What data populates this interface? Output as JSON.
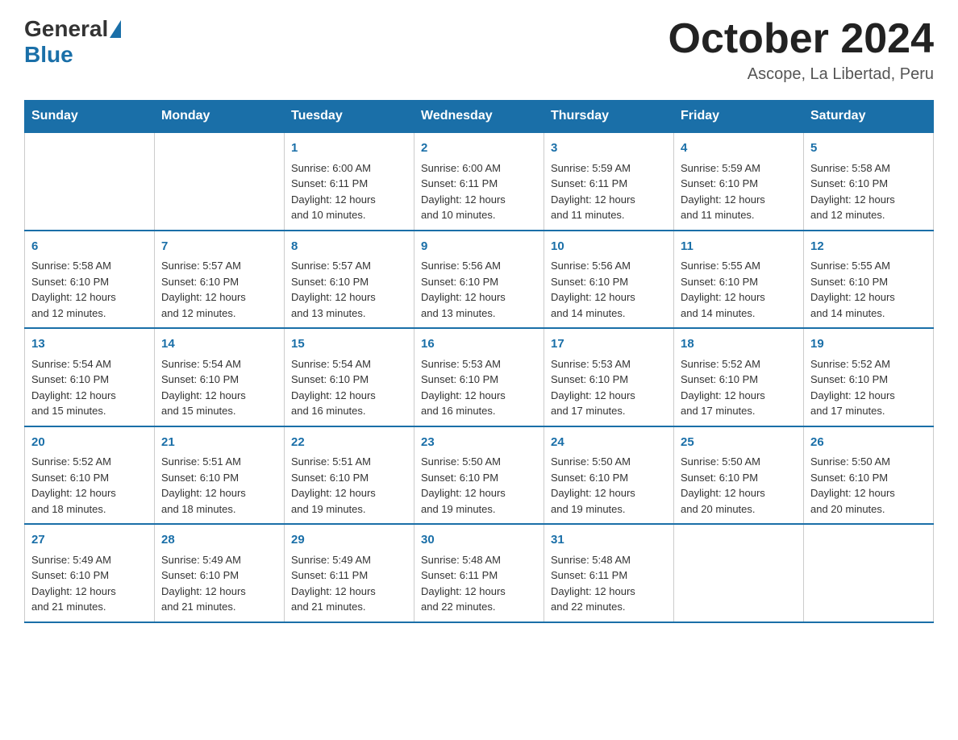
{
  "header": {
    "logo_general": "General",
    "logo_blue": "Blue",
    "month_title": "October 2024",
    "location": "Ascope, La Libertad, Peru"
  },
  "weekdays": [
    "Sunday",
    "Monday",
    "Tuesday",
    "Wednesday",
    "Thursday",
    "Friday",
    "Saturday"
  ],
  "weeks": [
    [
      {
        "day": "",
        "info": ""
      },
      {
        "day": "",
        "info": ""
      },
      {
        "day": "1",
        "info": "Sunrise: 6:00 AM\nSunset: 6:11 PM\nDaylight: 12 hours\nand 10 minutes."
      },
      {
        "day": "2",
        "info": "Sunrise: 6:00 AM\nSunset: 6:11 PM\nDaylight: 12 hours\nand 10 minutes."
      },
      {
        "day": "3",
        "info": "Sunrise: 5:59 AM\nSunset: 6:11 PM\nDaylight: 12 hours\nand 11 minutes."
      },
      {
        "day": "4",
        "info": "Sunrise: 5:59 AM\nSunset: 6:10 PM\nDaylight: 12 hours\nand 11 minutes."
      },
      {
        "day": "5",
        "info": "Sunrise: 5:58 AM\nSunset: 6:10 PM\nDaylight: 12 hours\nand 12 minutes."
      }
    ],
    [
      {
        "day": "6",
        "info": "Sunrise: 5:58 AM\nSunset: 6:10 PM\nDaylight: 12 hours\nand 12 minutes."
      },
      {
        "day": "7",
        "info": "Sunrise: 5:57 AM\nSunset: 6:10 PM\nDaylight: 12 hours\nand 12 minutes."
      },
      {
        "day": "8",
        "info": "Sunrise: 5:57 AM\nSunset: 6:10 PM\nDaylight: 12 hours\nand 13 minutes."
      },
      {
        "day": "9",
        "info": "Sunrise: 5:56 AM\nSunset: 6:10 PM\nDaylight: 12 hours\nand 13 minutes."
      },
      {
        "day": "10",
        "info": "Sunrise: 5:56 AM\nSunset: 6:10 PM\nDaylight: 12 hours\nand 14 minutes."
      },
      {
        "day": "11",
        "info": "Sunrise: 5:55 AM\nSunset: 6:10 PM\nDaylight: 12 hours\nand 14 minutes."
      },
      {
        "day": "12",
        "info": "Sunrise: 5:55 AM\nSunset: 6:10 PM\nDaylight: 12 hours\nand 14 minutes."
      }
    ],
    [
      {
        "day": "13",
        "info": "Sunrise: 5:54 AM\nSunset: 6:10 PM\nDaylight: 12 hours\nand 15 minutes."
      },
      {
        "day": "14",
        "info": "Sunrise: 5:54 AM\nSunset: 6:10 PM\nDaylight: 12 hours\nand 15 minutes."
      },
      {
        "day": "15",
        "info": "Sunrise: 5:54 AM\nSunset: 6:10 PM\nDaylight: 12 hours\nand 16 minutes."
      },
      {
        "day": "16",
        "info": "Sunrise: 5:53 AM\nSunset: 6:10 PM\nDaylight: 12 hours\nand 16 minutes."
      },
      {
        "day": "17",
        "info": "Sunrise: 5:53 AM\nSunset: 6:10 PM\nDaylight: 12 hours\nand 17 minutes."
      },
      {
        "day": "18",
        "info": "Sunrise: 5:52 AM\nSunset: 6:10 PM\nDaylight: 12 hours\nand 17 minutes."
      },
      {
        "day": "19",
        "info": "Sunrise: 5:52 AM\nSunset: 6:10 PM\nDaylight: 12 hours\nand 17 minutes."
      }
    ],
    [
      {
        "day": "20",
        "info": "Sunrise: 5:52 AM\nSunset: 6:10 PM\nDaylight: 12 hours\nand 18 minutes."
      },
      {
        "day": "21",
        "info": "Sunrise: 5:51 AM\nSunset: 6:10 PM\nDaylight: 12 hours\nand 18 minutes."
      },
      {
        "day": "22",
        "info": "Sunrise: 5:51 AM\nSunset: 6:10 PM\nDaylight: 12 hours\nand 19 minutes."
      },
      {
        "day": "23",
        "info": "Sunrise: 5:50 AM\nSunset: 6:10 PM\nDaylight: 12 hours\nand 19 minutes."
      },
      {
        "day": "24",
        "info": "Sunrise: 5:50 AM\nSunset: 6:10 PM\nDaylight: 12 hours\nand 19 minutes."
      },
      {
        "day": "25",
        "info": "Sunrise: 5:50 AM\nSunset: 6:10 PM\nDaylight: 12 hours\nand 20 minutes."
      },
      {
        "day": "26",
        "info": "Sunrise: 5:50 AM\nSunset: 6:10 PM\nDaylight: 12 hours\nand 20 minutes."
      }
    ],
    [
      {
        "day": "27",
        "info": "Sunrise: 5:49 AM\nSunset: 6:10 PM\nDaylight: 12 hours\nand 21 minutes."
      },
      {
        "day": "28",
        "info": "Sunrise: 5:49 AM\nSunset: 6:10 PM\nDaylight: 12 hours\nand 21 minutes."
      },
      {
        "day": "29",
        "info": "Sunrise: 5:49 AM\nSunset: 6:11 PM\nDaylight: 12 hours\nand 21 minutes."
      },
      {
        "day": "30",
        "info": "Sunrise: 5:48 AM\nSunset: 6:11 PM\nDaylight: 12 hours\nand 22 minutes."
      },
      {
        "day": "31",
        "info": "Sunrise: 5:48 AM\nSunset: 6:11 PM\nDaylight: 12 hours\nand 22 minutes."
      },
      {
        "day": "",
        "info": ""
      },
      {
        "day": "",
        "info": ""
      }
    ]
  ]
}
